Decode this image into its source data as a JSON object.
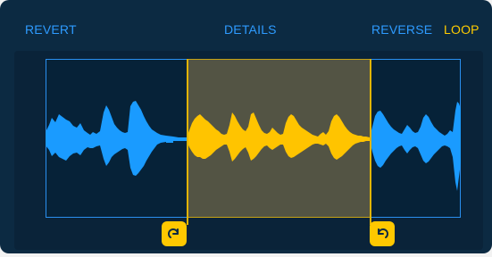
{
  "toolbar": {
    "revert_label": "REVERT",
    "details_label": "DETAILS",
    "reverse_label": "REVERSE",
    "loop_label": "LOOP"
  },
  "colors": {
    "accent_blue": "#2e9bff",
    "loop_yellow": "#ffc800",
    "panel_background": "#0c2a42"
  },
  "icons": {
    "loop_start_handle": "loop-start-arrow-icon",
    "loop_end_handle": "loop-end-arrow-icon"
  }
}
